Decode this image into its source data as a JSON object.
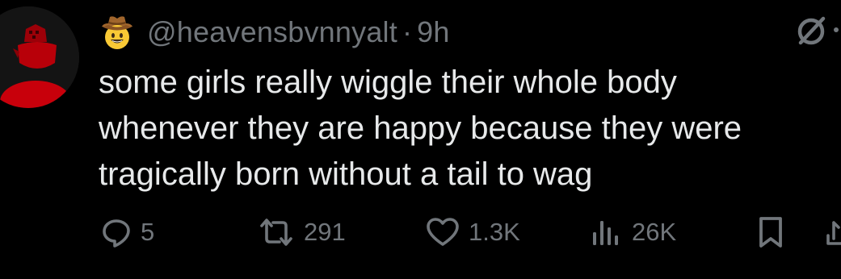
{
  "tweet": {
    "handle": "@heavensbvnnyalt",
    "separator": "·",
    "time": "9h",
    "name_emoji": "cowboy-hat-face-icon",
    "text": "some girls really wiggle their whole body\nwhenever they are happy because they were\ntragically born without a tail to wag"
  },
  "actions": {
    "replies": "5",
    "retweets": "291",
    "likes": "1.3K",
    "views": "26K"
  },
  "colors": {
    "background": "#000000",
    "text": "#e7e9ea",
    "secondary": "#71767b",
    "avatar_accent": "#c8000b"
  },
  "icons": {
    "avatar": "avatar",
    "grok": "grok-icon",
    "reply": "reply-icon",
    "retweet": "retweet-icon",
    "like": "heart-icon",
    "views": "views-icon",
    "bookmark": "bookmark-icon",
    "share": "share-icon"
  }
}
